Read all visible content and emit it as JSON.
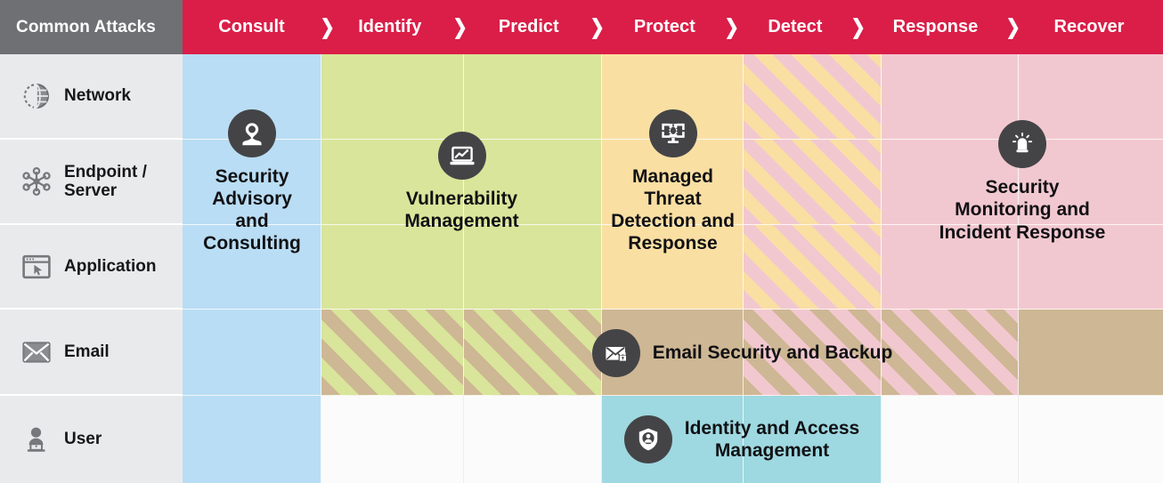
{
  "header": {
    "corner_label": "Common Attacks",
    "separator": "❯",
    "phases": [
      {
        "label": "Consult",
        "color": "#b9ddf4"
      },
      {
        "label": "Identify",
        "color": "#d9e59a"
      },
      {
        "label": "Predict",
        "color": "#d9e59a"
      },
      {
        "label": "Protect",
        "color": "#fadfa3"
      },
      {
        "label": "Detect",
        "color": "hatch-orange-pink"
      },
      {
        "label": "Response",
        "color": "#f2c8d0"
      },
      {
        "label": "Recover",
        "color": "#f2c8d0"
      }
    ],
    "bar_color": "#da1e48",
    "corner_color": "#6f7073"
  },
  "rows": [
    {
      "label": "Network",
      "icon": "globe-network-icon"
    },
    {
      "label": "Endpoint /\nServer",
      "icon": "node-cluster-icon"
    },
    {
      "label": "Application",
      "icon": "app-window-cursor-icon"
    },
    {
      "label": "Email",
      "icon": "envelope-icon"
    },
    {
      "label": "User",
      "icon": "user-laptop-icon"
    }
  ],
  "services": [
    {
      "name": "Security Advisory and Consulting",
      "label": "Security\nAdvisory\nand\nConsulting",
      "icon": "consultant-pin-icon",
      "bg": "#b9ddf4"
    },
    {
      "name": "Vulnerability Management",
      "label": "Vulnerability\nManagement",
      "icon": "laptop-chart-icon",
      "bg": "#d9e59a"
    },
    {
      "name": "Managed Threat Detection and Response",
      "label": "Managed\nThreat\nDetection and\nResponse",
      "icon": "monitor-bug-icon",
      "bg": "#fadfa3"
    },
    {
      "name": "Security Monitoring and Incident Response",
      "label": "Security\nMonitoring and\nIncident Response",
      "icon": "alarm-siren-icon",
      "bg": "#f2c8d0"
    },
    {
      "name": "Email Security and Backup",
      "label": "Email Security and Backup",
      "icon": "envelope-lock-icon",
      "bg": "#ceb794"
    },
    {
      "name": "Identity and Access Management",
      "label": "Identity and Access\nManagement",
      "icon": "shield-user-icon",
      "bg": "#9ed8e0"
    }
  ],
  "palette": {
    "blue": "#b9ddf4",
    "green": "#d9e59a",
    "orange": "#fadfa3",
    "pink": "#f2c8d0",
    "tan": "#ceb794",
    "teal": "#9ed8e0",
    "empty": "#fbfbfb",
    "sidebar": "#e9eaec",
    "icon_circle": "#444447"
  }
}
